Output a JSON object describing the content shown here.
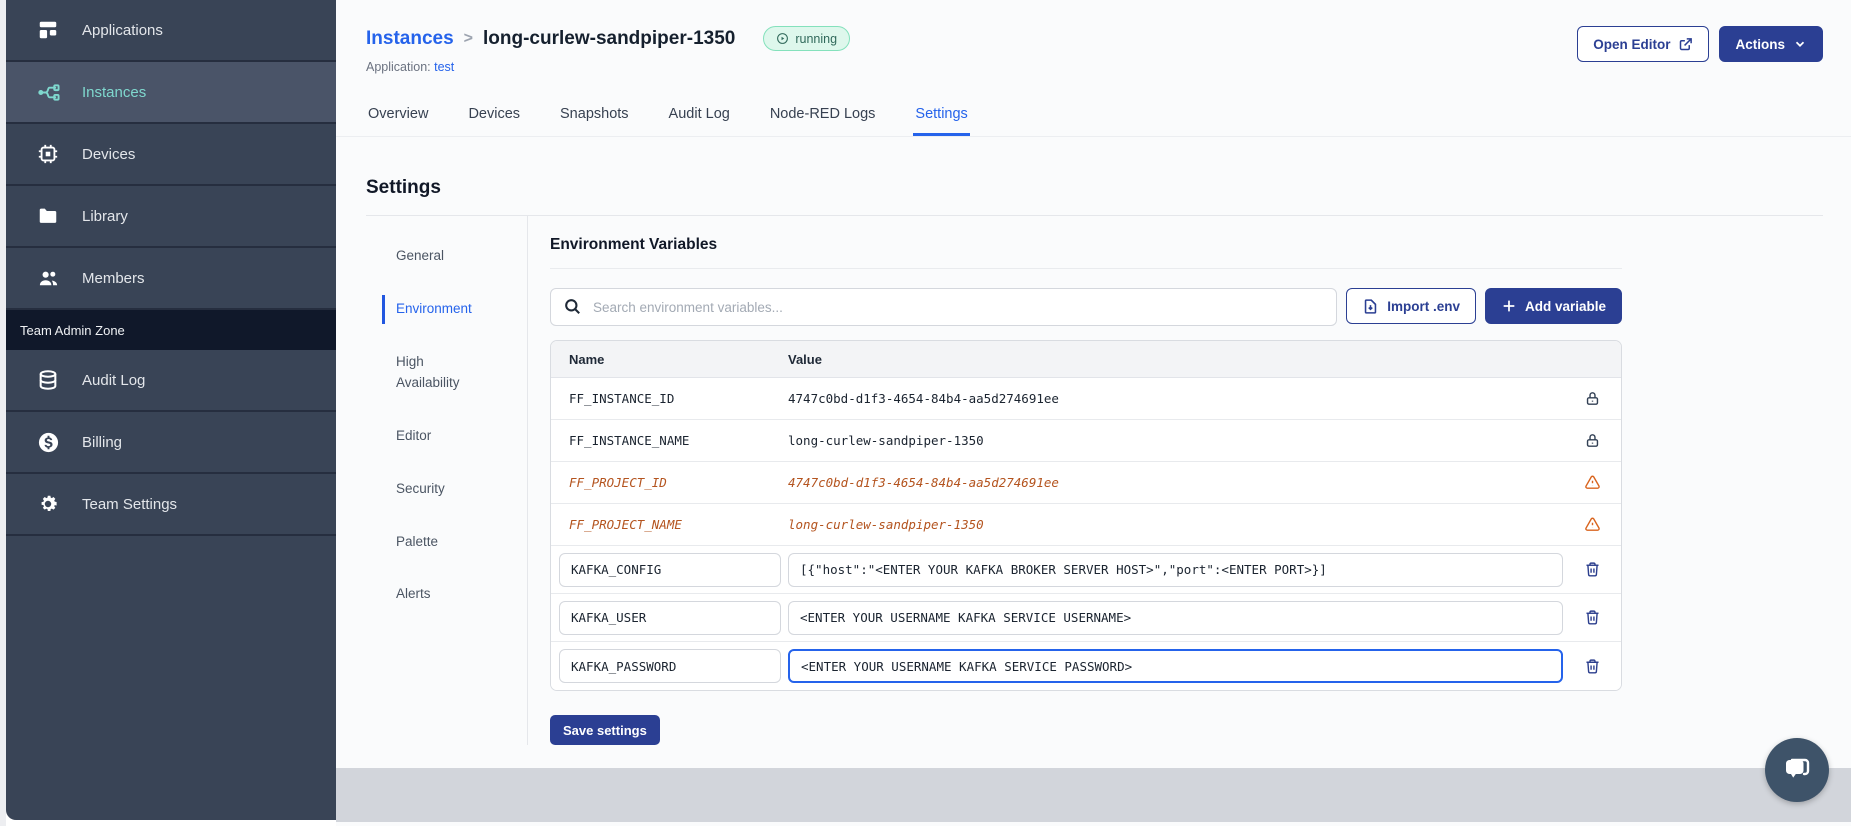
{
  "sidebar": {
    "items": [
      {
        "label": "Applications",
        "icon": "applications-icon"
      },
      {
        "label": "Instances",
        "icon": "instances-icon"
      },
      {
        "label": "Devices",
        "icon": "devices-icon"
      },
      {
        "label": "Library",
        "icon": "library-icon"
      },
      {
        "label": "Members",
        "icon": "members-icon"
      }
    ],
    "active_item": "Instances",
    "admin_zone_label": "Team Admin Zone",
    "admin_items": [
      {
        "label": "Audit Log",
        "icon": "audit-log-icon"
      },
      {
        "label": "Billing",
        "icon": "billing-icon"
      },
      {
        "label": "Team Settings",
        "icon": "gear-icon"
      }
    ]
  },
  "header": {
    "breadcrumb_parent": "Instances",
    "breadcrumb_separator": ">",
    "instance_name": "long-curlew-sandpiper-1350",
    "status": "running",
    "application_label": "Application:",
    "application_name": "test",
    "open_editor_label": "Open Editor",
    "actions_label": "Actions"
  },
  "tabs": [
    {
      "label": "Overview"
    },
    {
      "label": "Devices"
    },
    {
      "label": "Snapshots"
    },
    {
      "label": "Audit Log"
    },
    {
      "label": "Node-RED Logs"
    },
    {
      "label": "Settings"
    }
  ],
  "active_tab": "Settings",
  "settings": {
    "title": "Settings",
    "nav": [
      {
        "label": "General"
      },
      {
        "label": "Environment"
      },
      {
        "label": "High Availability"
      },
      {
        "label": "Editor"
      },
      {
        "label": "Security"
      },
      {
        "label": "Palette"
      },
      {
        "label": "Alerts"
      }
    ],
    "active_nav": "Environment"
  },
  "env": {
    "title": "Environment Variables",
    "search_placeholder": "Search environment variables...",
    "import_label": "Import .env",
    "add_label": "Add variable",
    "save_label": "Save settings",
    "table": {
      "headers": [
        "Name",
        "Value"
      ],
      "rows": [
        {
          "name": "FF_INSTANCE_ID",
          "value": "4747c0bd-d1f3-4654-84b4-aa5d274691ee",
          "state": "locked"
        },
        {
          "name": "FF_INSTANCE_NAME",
          "value": "long-curlew-sandpiper-1350",
          "state": "locked"
        },
        {
          "name": "FF_PROJECT_ID",
          "value": "4747c0bd-d1f3-4654-84b4-aa5d274691ee",
          "state": "deprecated"
        },
        {
          "name": "FF_PROJECT_NAME",
          "value": "long-curlew-sandpiper-1350",
          "state": "deprecated"
        },
        {
          "name": "KAFKA_CONFIG",
          "value": "[{\"host\":\"<ENTER YOUR KAFKA BROKER SERVER HOST>\",\"port\":<ENTER PORT>}]",
          "state": "editable"
        },
        {
          "name": "KAFKA_USER",
          "value": "<ENTER YOUR USERNAME KAFKA SERVICE USERNAME>",
          "state": "editable"
        },
        {
          "name": "KAFKA_PASSWORD",
          "value": "<ENTER YOUR USERNAME KAFKA SERVICE PASSWORD>",
          "state": "editable-focused"
        }
      ]
    }
  },
  "colors": {
    "sidebar_bg": "#394456",
    "sidebar_active_bg": "#4a5468",
    "sidebar_active_teal": "#7fd8ce",
    "admin_band_bg": "#10182a",
    "link_blue": "#2563eb",
    "accent_navy": "#2b3f93",
    "badge_bg": "#def7ec",
    "badge_border": "#84e1bc",
    "badge_text": "#31695b",
    "deprecated_text": "#b4541f",
    "warning_icon": "#d9641e",
    "focus_border": "#2563eb",
    "bottom_band": "#d2d5db"
  }
}
